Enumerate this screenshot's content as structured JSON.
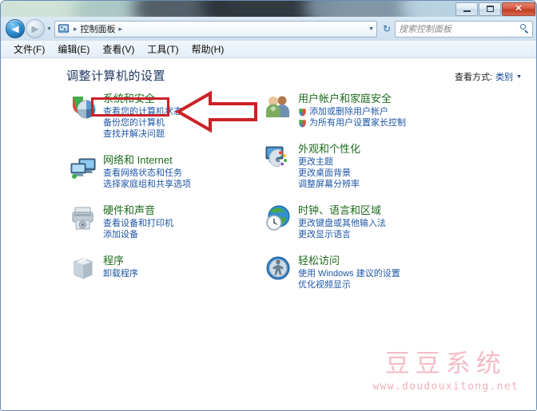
{
  "window": {
    "controls": {
      "minimize_label": "–",
      "maximize_label": "□",
      "close_label": "✕"
    }
  },
  "addressbar": {
    "back_glyph": "◀",
    "forward_glyph": "▶",
    "history_caret": "▼",
    "path_root": "控制面板",
    "separator": "▸",
    "dropdown_caret": "▼",
    "refresh_glyph": "↻"
  },
  "search": {
    "placeholder": "搜索控制面板"
  },
  "menu": {
    "items": [
      {
        "label": "文件(F)"
      },
      {
        "label": "编辑(E)"
      },
      {
        "label": "查看(V)"
      },
      {
        "label": "工具(T)"
      },
      {
        "label": "帮助(H)"
      }
    ]
  },
  "main": {
    "title": "调整计算机的设置",
    "view_by_label": "查看方式:",
    "view_by_value": "类别",
    "view_by_caret": "▼"
  },
  "categories_left": [
    {
      "icon": "shield-security-icon",
      "title": "系统和安全",
      "links": [
        {
          "text": "查看您的计算机状态",
          "shield": false
        },
        {
          "text": "备份您的计算机",
          "shield": false
        },
        {
          "text": "查找并解决问题",
          "shield": false
        }
      ]
    },
    {
      "icon": "network-icon",
      "title": "网络和 Internet",
      "links": [
        {
          "text": "查看网络状态和任务",
          "shield": false
        },
        {
          "text": "选择家庭组和共享选项",
          "shield": false
        }
      ]
    },
    {
      "icon": "hardware-sound-icon",
      "title": "硬件和声音",
      "links": [
        {
          "text": "查看设备和打印机",
          "shield": false
        },
        {
          "text": "添加设备",
          "shield": false
        }
      ]
    },
    {
      "icon": "programs-icon",
      "title": "程序",
      "links": [
        {
          "text": "卸载程序",
          "shield": false
        }
      ]
    }
  ],
  "categories_right": [
    {
      "icon": "user-accounts-icon",
      "title": "用户帐户和家庭安全",
      "links": [
        {
          "text": "添加或删除用户帐户",
          "shield": true
        },
        {
          "text": "为所有用户设置家长控制",
          "shield": true
        }
      ]
    },
    {
      "icon": "appearance-icon",
      "title": "外观和个性化",
      "links": [
        {
          "text": "更改主题",
          "shield": false
        },
        {
          "text": "更改桌面背景",
          "shield": false
        },
        {
          "text": "调整屏幕分辨率",
          "shield": false
        }
      ]
    },
    {
      "icon": "clock-language-icon",
      "title": "时钟、语言和区域",
      "links": [
        {
          "text": "更改键盘或其他输入法",
          "shield": false
        },
        {
          "text": "更改显示语言",
          "shield": false
        }
      ]
    },
    {
      "icon": "ease-of-access-icon",
      "title": "轻松访问",
      "links": [
        {
          "text": "使用 Windows 建议的设置",
          "shield": false
        },
        {
          "text": "优化视频显示",
          "shield": false
        }
      ]
    }
  ],
  "annotation": {
    "highlight_color": "#cc2127",
    "highlight_target": "系统和安全",
    "arrow_direction": "left"
  },
  "watermark": {
    "brand": "豆豆系统",
    "url": "www.doudouxitong.net",
    "color": "#f4bcc8"
  }
}
